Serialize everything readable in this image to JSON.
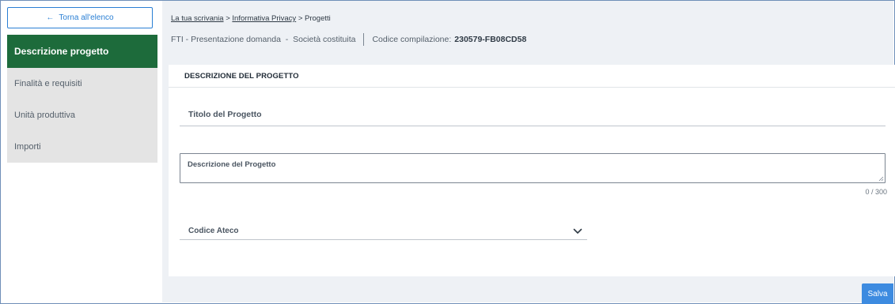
{
  "sidebar": {
    "back_label": "Torna all'elenco",
    "back_arrow": "←",
    "items": [
      {
        "label": "Descrizione progetto",
        "active": true
      },
      {
        "label": "Finalità e requisiti",
        "active": false
      },
      {
        "label": "Unità produttiva",
        "active": false
      },
      {
        "label": "Importi",
        "active": false
      }
    ]
  },
  "breadcrumb": {
    "items": [
      "La tua scrivania",
      "Informativa Privacy",
      "Progetti"
    ],
    "separator": ">"
  },
  "subheader": {
    "description": "FTI - Presentazione domanda  -  Società costituita",
    "code_label": "Codice compilazione:",
    "code_value": "230579-FB08CD58"
  },
  "form": {
    "section_title": "DESCRIZIONE DEL PROGETTO",
    "title_field_label": "Titolo del Progetto",
    "description_field_label": "Descrizione del Progetto",
    "description_counter": "0 / 300",
    "ateco_field_label": "Codice Ateco"
  },
  "actions": {
    "save_label": "Salva"
  },
  "colors": {
    "active_menu": "#1d6b3b",
    "primary": "#2a7fd4",
    "save_button": "#3d8be0"
  }
}
